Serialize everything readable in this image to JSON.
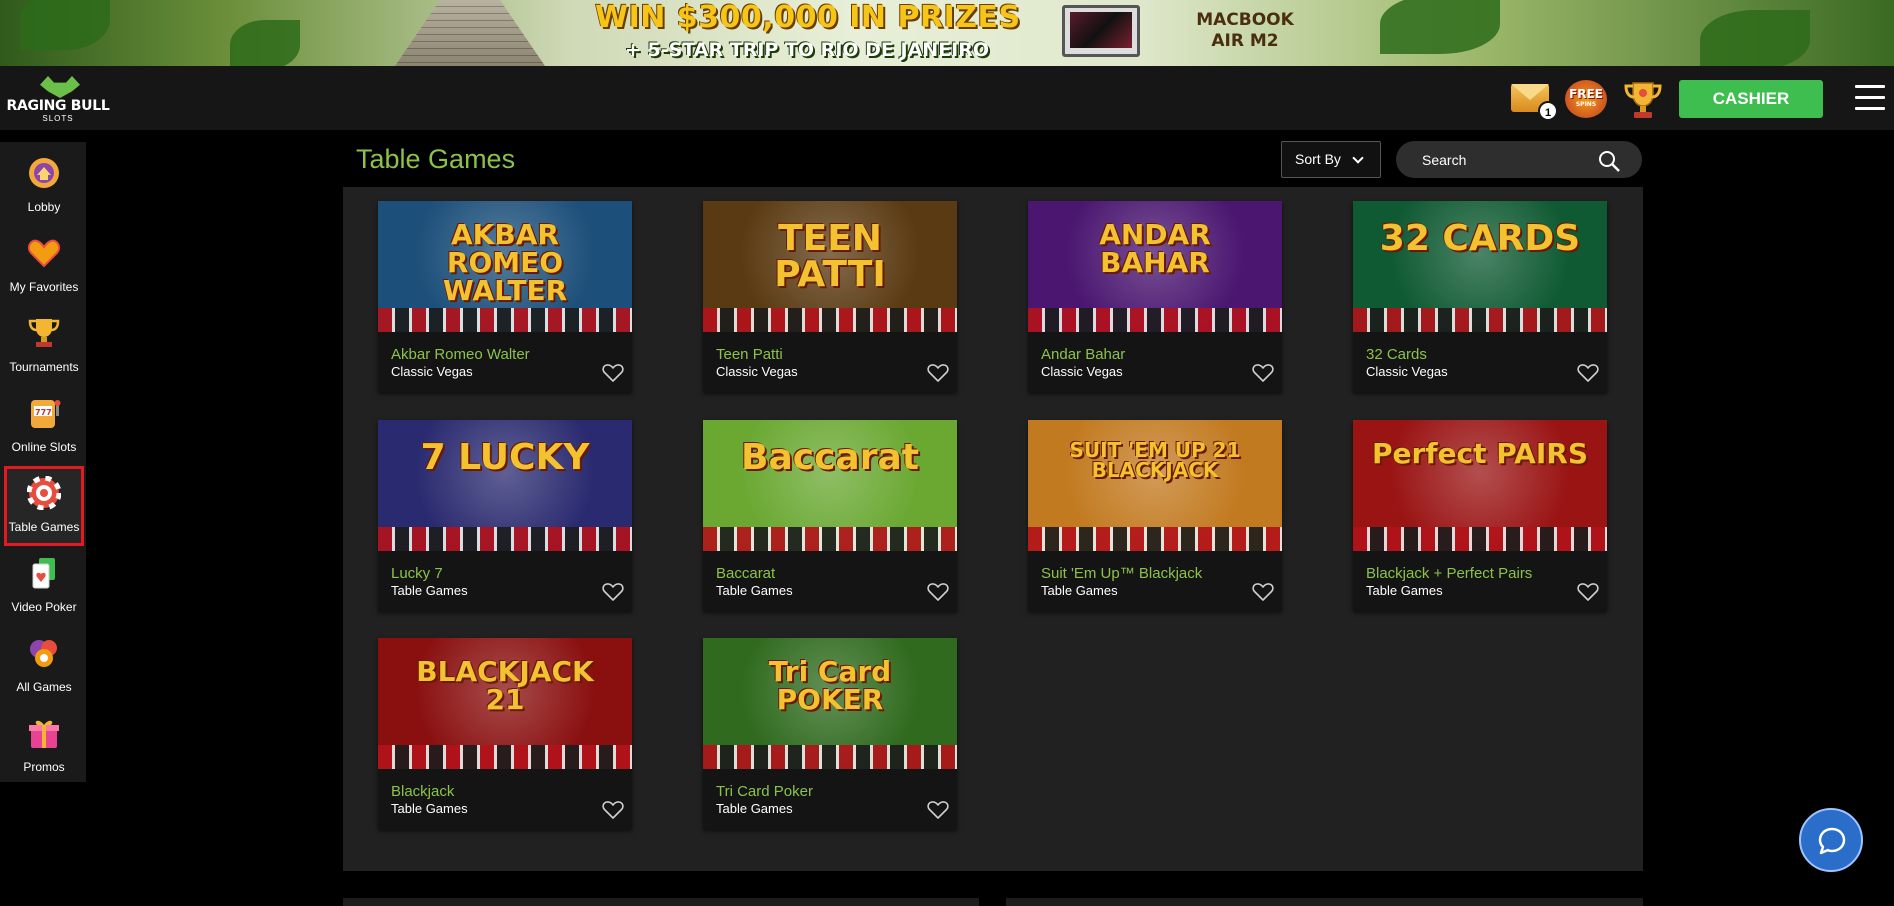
{
  "banner": {
    "headline": "WIN $300,000 IN PRIZES",
    "subline": "+ 5-STAR TRIP TO RIO DE JANEIRO",
    "prize_line1": "MACBOOK",
    "prize_line2": "AIR M2"
  },
  "header": {
    "logo_brand": "RAGING BULL",
    "logo_sub": "SLOTS",
    "mail_count": "1",
    "free_spins_big": "FREE",
    "free_spins_small": "SPINS",
    "cashier_label": "CASHIER"
  },
  "sidebar": {
    "items": [
      {
        "label": "Lobby",
        "icon": "lobby-icon"
      },
      {
        "label": "My Favorites",
        "icon": "heart-icon"
      },
      {
        "label": "Tournaments",
        "icon": "trophy-icon"
      },
      {
        "label": "Online Slots",
        "icon": "slot-machine-icon"
      },
      {
        "label": "Table Games",
        "icon": "poker-chip-icon",
        "active": true
      },
      {
        "label": "Video Poker",
        "icon": "cards-icon"
      },
      {
        "label": "All Games",
        "icon": "all-games-icon"
      },
      {
        "label": "Promos",
        "icon": "gift-icon"
      }
    ]
  },
  "main": {
    "title": "Table Games",
    "sort_label": "Sort By",
    "search_placeholder": "Search",
    "games": [
      {
        "name": "Akbar Romeo Walter",
        "category": "Classic Vegas",
        "art": "AKBAR ROMEO WALTER",
        "bg": "#1c4f7a"
      },
      {
        "name": "Teen Patti",
        "category": "Classic Vegas",
        "art": "TEEN PATTI",
        "bg": "#5a3a12"
      },
      {
        "name": "Andar Bahar",
        "category": "Classic Vegas",
        "art": "ANDAR BAHAR",
        "bg": "#4a1670"
      },
      {
        "name": "32 Cards",
        "category": "Classic Vegas",
        "art": "32 CARDS",
        "bg": "#0f5a33"
      },
      {
        "name": "Lucky 7",
        "category": "Table Games",
        "art": "7 LUCKY",
        "bg": "#2a2a70"
      },
      {
        "name": "Baccarat",
        "category": "Table Games",
        "art": "Baccarat",
        "bg": "#6aa832"
      },
      {
        "name": "Suit 'Em Up™ Blackjack",
        "category": "Table Games",
        "art": "SUIT 'EM UP 21 BLACKJACK",
        "bg": "#c27a20"
      },
      {
        "name": "Blackjack + Perfect Pairs",
        "category": "Table Games",
        "art": "Perfect PAIRS",
        "bg": "#9a1414"
      },
      {
        "name": "Blackjack",
        "category": "Table Games",
        "art": "BLACKJACK 21",
        "bg": "#8a1010"
      },
      {
        "name": "Tri Card Poker",
        "category": "Table Games",
        "art": "Tri Card POKER",
        "bg": "#2f6a1e"
      }
    ]
  },
  "colors": {
    "accent_green": "#8bc34a",
    "cashier_green": "#3dbe4f",
    "active_outline": "#e21b23",
    "chat_blue": "#2a6ec9"
  }
}
